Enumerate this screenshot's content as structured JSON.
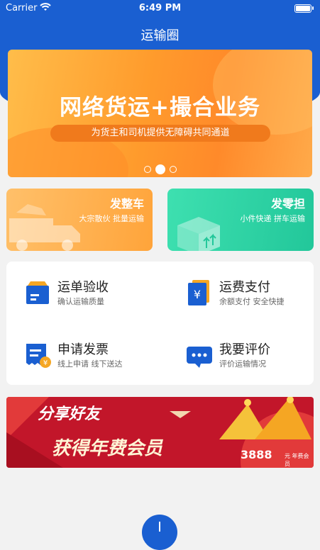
{
  "status_bar": {
    "carrier": "Carrier",
    "time": "6:49 PM"
  },
  "nav": {
    "title": "运输圈"
  },
  "banner": {
    "headline": "网络货运+撮合业务",
    "subtitle": "为货主和司机提供无障碍共同通道",
    "dots": 3,
    "active_dot": 2
  },
  "cards": [
    {
      "title": "发整车",
      "desc": "大宗散伙  批量运输",
      "color": "#ffa43a",
      "icon": "truck-icon"
    },
    {
      "title": "发零担",
      "desc": "小件快递  拼车运输",
      "color": "#22c79a",
      "icon": "package-icon"
    }
  ],
  "services": [
    {
      "name": "运单验收",
      "note": "确认运输质量",
      "icon": "waybill-icon"
    },
    {
      "name": "运费支付",
      "note": "余额支付 安全快捷",
      "icon": "yuan-payment-icon"
    },
    {
      "name": "申请发票",
      "note": "线上申请 线下送达",
      "icon": "invoice-icon"
    },
    {
      "name": "我要评价",
      "note": "评价运输情况",
      "icon": "chat-bubble-icon"
    }
  ],
  "promo": {
    "line1": "分享好友",
    "line2": "获得年费会员",
    "price": "3888",
    "unit": "元 年费会员"
  },
  "colors": {
    "brand_blue": "#1a5fd1",
    "background": "#f2f2f2"
  }
}
